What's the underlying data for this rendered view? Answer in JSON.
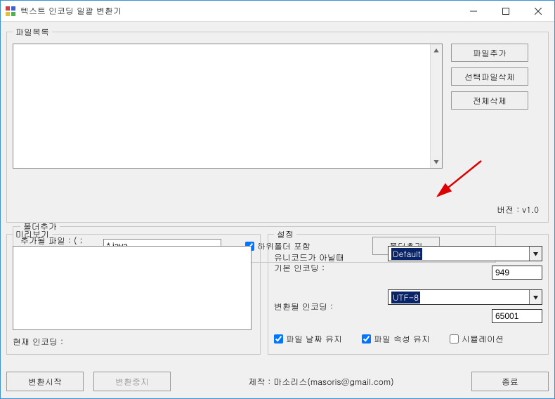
{
  "window": {
    "title": "텍스트 인코딩 일괄 변환기"
  },
  "filelist": {
    "legend": "파일목록",
    "buttons": {
      "add_file": "파일추가",
      "delete_selected": "선택파일삭제",
      "delete_all": "전체삭제"
    }
  },
  "folder_add": {
    "legend": "폴더추가",
    "pattern_label": "추가될 파일 : ( ;\n로 구분 )",
    "pattern_value": "*.java",
    "include_sub_label": "하위폴더 포함",
    "include_sub_checked": true,
    "button": "폴더추가"
  },
  "version": "버전 : v1.0",
  "preview": {
    "legend": "미리보기",
    "current_encoding_label": "현재 인코딩 :"
  },
  "settings": {
    "legend": "설정",
    "default_enc_label": "유니코드가 아닐때\n기본 인코딩 :",
    "default_enc_value": "Default",
    "default_enc_code": "949",
    "target_enc_label": "변환될 인코딩 :",
    "target_enc_value": "UTF-8",
    "target_enc_code": "65001",
    "keep_date_label": "파일 날짜 유지",
    "keep_date_checked": true,
    "keep_attr_label": "파일 속성 유지",
    "keep_attr_checked": true,
    "simulation_label": "시뮬레이션",
    "simulation_checked": false
  },
  "footer": {
    "start": "변환시작",
    "stop": "변환중지",
    "credit": "제작 : 마소리스(masoris@gmail.com)",
    "exit": "종료"
  }
}
